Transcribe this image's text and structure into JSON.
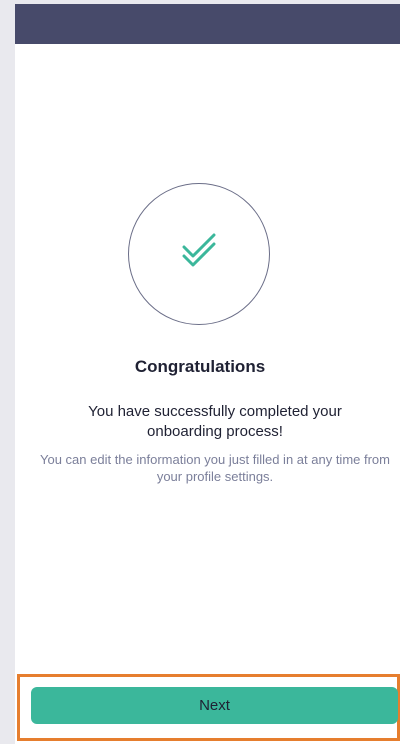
{
  "header": {
    "background_color": "#474a6a"
  },
  "success": {
    "icon": "double-check-icon",
    "icon_color": "#3bb79b",
    "title": "Congratulations",
    "message": "You have successfully completed your onboarding process!",
    "hint": "You can edit the information you just filled in at any time from your profile settings."
  },
  "footer": {
    "next_label": "Next",
    "button_color": "#3bb79b",
    "highlight_color": "#e67e2e"
  }
}
